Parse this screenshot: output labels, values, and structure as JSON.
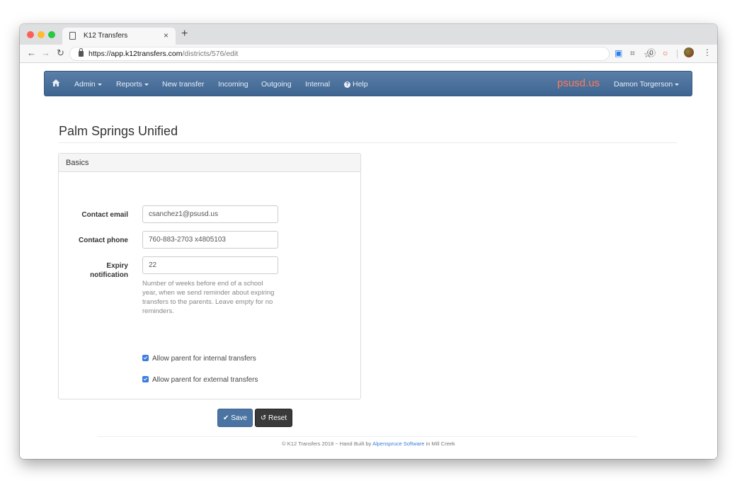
{
  "browser": {
    "tab_title": "K12 Transfers",
    "tab_close": "×",
    "new_tab": "+",
    "url_prefix": "https://",
    "url_host": "app.k12transfers.com",
    "url_path": "/districts/576/edit"
  },
  "navbar": {
    "items": [
      {
        "label": "Admin",
        "dropdown": true
      },
      {
        "label": "Reports",
        "dropdown": true
      },
      {
        "label": "New transfer"
      },
      {
        "label": "Incoming"
      },
      {
        "label": "Outgoing"
      },
      {
        "label": "Internal"
      },
      {
        "label": "Help"
      }
    ],
    "brand": "psusd.us",
    "user": "Damon Torgerson",
    "colors": {
      "bar": "#3e6591",
      "brand": "#ff7a5c"
    }
  },
  "page": {
    "title": "Palm Springs Unified"
  },
  "panel": {
    "title": "Basics",
    "fields": {
      "contact_email": {
        "label": "Contact email",
        "value": "csanchez1@psusd.us"
      },
      "contact_phone": {
        "label": "Contact phone",
        "value": "760-883-2703 x4805103"
      },
      "expiry_notification": {
        "label_line1": "Expiry",
        "label_line2": "notification",
        "value": "22",
        "help": "Number of weeks before end of a school year, when we send reminder about expiring transfers to the parents. Leave empty for no reminders."
      }
    },
    "checkboxes": [
      {
        "label": "Allow parent for internal transfers",
        "checked": true
      },
      {
        "label": "Allow parent for external transfers",
        "checked": true
      }
    ]
  },
  "actions": {
    "save_label": "Save",
    "reset_label": "Reset"
  },
  "footer": {
    "prefix": "© K12 Transfers 2018 ~ Hand Built by ",
    "link": "Alpenspruce Software",
    "suffix": " in Mill Creek"
  }
}
